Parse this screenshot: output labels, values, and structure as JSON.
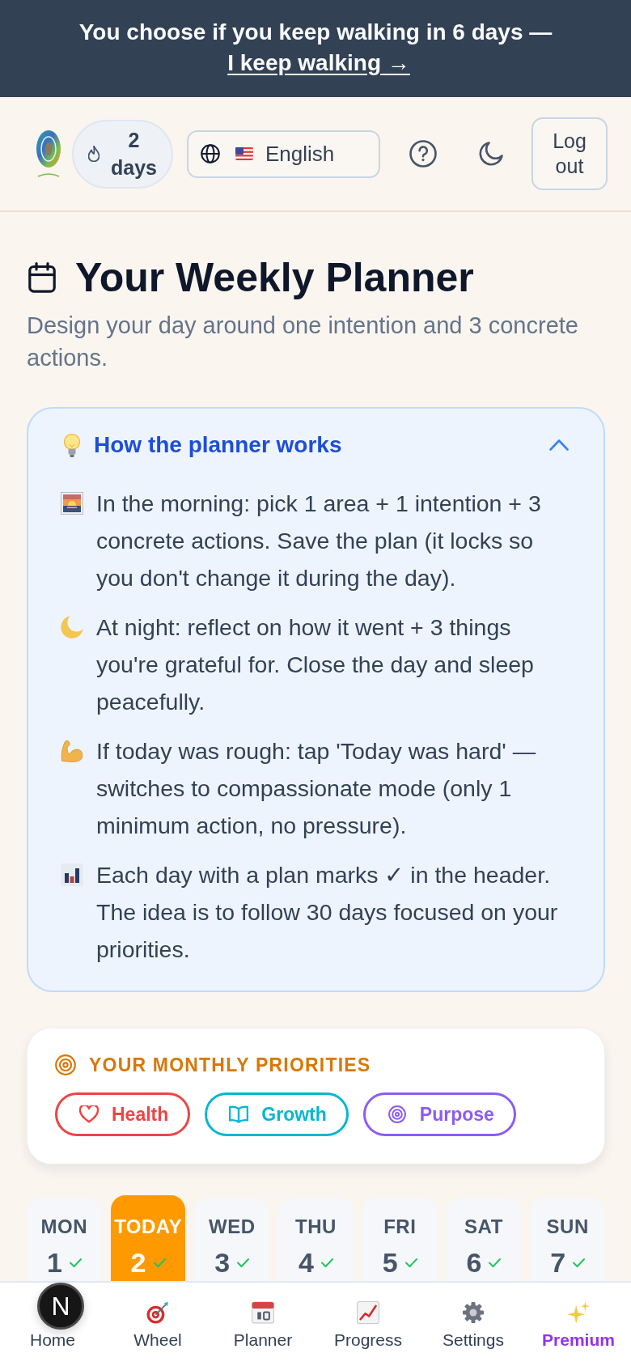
{
  "banner": {
    "text": "You choose if you keep walking in 6 days —",
    "link": "I keep walking →"
  },
  "header": {
    "streak": "2 days",
    "language": "English",
    "logout": "Log out"
  },
  "page": {
    "title": "Your Weekly Planner",
    "subtitle": "Design your day around one intention and 3 concrete actions."
  },
  "how_it_works": {
    "title": "How the planner works",
    "expanded": true,
    "steps": [
      {
        "kind": "sunrise",
        "text": "In the morning: pick 1 area + 1 intention + 3 concrete actions. Save the plan (it locks so you don't change it during the day)."
      },
      {
        "kind": "moon",
        "text": "At night: reflect on how it went + 3 things you're grateful for. Close the day and sleep peacefully."
      },
      {
        "kind": "muscle",
        "text": "If today was rough: tap 'Today was hard' — switches to compassionate mode (only 1 minimum action, no pressure)."
      },
      {
        "kind": "chart",
        "text": "Each day with a plan marks ✓ in the header. The idea is to follow 30 days focused on your priorities."
      }
    ]
  },
  "priorities": {
    "title": "YOUR MONTHLY PRIORITIES",
    "items": [
      {
        "label": "Health",
        "kind": "heart",
        "color": "#ef4444"
      },
      {
        "label": "Growth",
        "kind": "book",
        "color": "#06b6d4"
      },
      {
        "label": "Purpose",
        "kind": "target",
        "color": "#8b5cf6"
      }
    ]
  },
  "week": [
    {
      "day": "MON",
      "date": "1",
      "selected": false,
      "checked": true
    },
    {
      "day": "TODAY",
      "date": "2",
      "selected": true,
      "checked": true
    },
    {
      "day": "WED",
      "date": "3",
      "selected": false,
      "checked": true
    },
    {
      "day": "THU",
      "date": "4",
      "selected": false,
      "checked": true
    },
    {
      "day": "FRI",
      "date": "5",
      "selected": false,
      "checked": true
    },
    {
      "day": "SAT",
      "date": "6",
      "selected": false,
      "checked": true
    },
    {
      "day": "SUN",
      "date": "7",
      "selected": false,
      "checked": true
    }
  ],
  "nav": [
    {
      "label": "Home",
      "highlighted": false
    },
    {
      "label": "Wheel",
      "kind": "target",
      "highlighted": false
    },
    {
      "label": "Planner",
      "kind": "calendar",
      "highlighted": false
    },
    {
      "label": "Progress",
      "kind": "chart",
      "highlighted": false
    },
    {
      "label": "Settings",
      "kind": "gear",
      "highlighted": false
    },
    {
      "label": "Premium",
      "kind": "sparkles",
      "highlighted": true
    }
  ],
  "dev_badge": {
    "label": "N"
  }
}
